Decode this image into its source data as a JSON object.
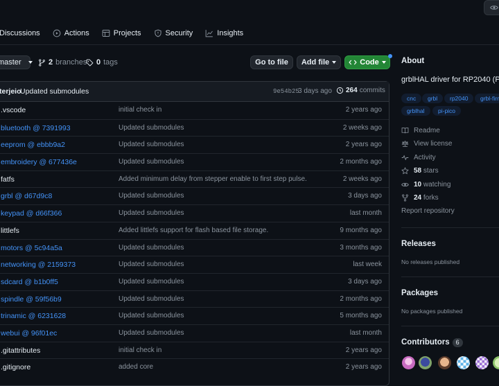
{
  "tabs": [
    {
      "label": "Discussions",
      "icon": "discussions-icon"
    },
    {
      "label": "Actions",
      "icon": "play-icon"
    },
    {
      "label": "Projects",
      "icon": "table-icon"
    },
    {
      "label": "Security",
      "icon": "shield-icon"
    },
    {
      "label": "Insights",
      "icon": "graph-icon"
    }
  ],
  "toolbar": {
    "branch": "master",
    "branches_count": "2",
    "branches_label": "branches",
    "tags_count": "0",
    "tags_label": "tags",
    "go_to_file": "Go to file",
    "add_file": "Add file",
    "code": "Code"
  },
  "commit": {
    "author": "terjeio",
    "message": "Updated submodules",
    "sha": "9e54b25",
    "time": "3 days ago",
    "count": "264",
    "count_label": "commits"
  },
  "files": [
    {
      "name": ".vscode",
      "link": false,
      "message": "initial check in",
      "age": "2 years ago"
    },
    {
      "name": "bluetooth @ 7391993",
      "link": true,
      "message": "Updated submodules",
      "age": "2 weeks ago"
    },
    {
      "name": "eeprom @ ebbb9a2",
      "link": true,
      "message": "Updated submodules",
      "age": "2 years ago"
    },
    {
      "name": "embroidery @ 677436e",
      "link": true,
      "message": "Updated submodules",
      "age": "2 months ago"
    },
    {
      "name": "fatfs",
      "link": false,
      "message": "Added minimum delay from stepper enable to first step pulse.",
      "age": "2 weeks ago"
    },
    {
      "name": "grbl @ d67d9c8",
      "link": true,
      "message": "Updated submodules",
      "age": "3 days ago"
    },
    {
      "name": "keypad @ d66f366",
      "link": true,
      "message": "Updated submodules",
      "age": "last month"
    },
    {
      "name": "littlefs",
      "link": false,
      "message": "Added littlefs support for flash based file storage.",
      "age": "9 months ago"
    },
    {
      "name": "motors @ 5c94a5a",
      "link": true,
      "message": "Updated submodules",
      "age": "3 months ago"
    },
    {
      "name": "networking @ 2159373",
      "link": true,
      "message": "Updated submodules",
      "age": "last week"
    },
    {
      "name": "sdcard @ b1b0ff5",
      "link": true,
      "message": "Updated submodules",
      "age": "3 days ago"
    },
    {
      "name": "spindle @ 59f56b9",
      "link": true,
      "message": "Updated submodules",
      "age": "2 months ago"
    },
    {
      "name": "trinamic @ 6231628",
      "link": true,
      "message": "Updated submodules",
      "age": "5 months ago"
    },
    {
      "name": "webui @ 96f01ec",
      "link": true,
      "message": "Updated submodules",
      "age": "last month"
    },
    {
      "name": ".gitattributes",
      "link": false,
      "message": "initial check in",
      "age": "2 years ago"
    },
    {
      "name": ".gitignore",
      "link": false,
      "message": "added core",
      "age": "2 years ago"
    }
  ],
  "about": {
    "heading": "About",
    "description": "grblHAL driver for RP2040 (Pi",
    "topics": [
      "cnc",
      "grbl",
      "rp2040",
      "grbl-firm",
      "grblhal",
      "pi-pico"
    ],
    "readme": "Readme",
    "license": "View license",
    "activity": "Activity",
    "stars_count": "58",
    "stars_label": "stars",
    "watching_count": "10",
    "watching_label": "watching",
    "forks_count": "24",
    "forks_label": "forks",
    "report": "Report repository"
  },
  "releases": {
    "heading": "Releases",
    "note": "No releases published"
  },
  "packages": {
    "heading": "Packages",
    "note": "No packages published"
  },
  "contributors": {
    "heading": "Contributors",
    "count": "6"
  },
  "colors": {
    "background": "#0d1117",
    "link": "#4493f8",
    "code_button": "#238636",
    "muted": "#8b949e"
  }
}
